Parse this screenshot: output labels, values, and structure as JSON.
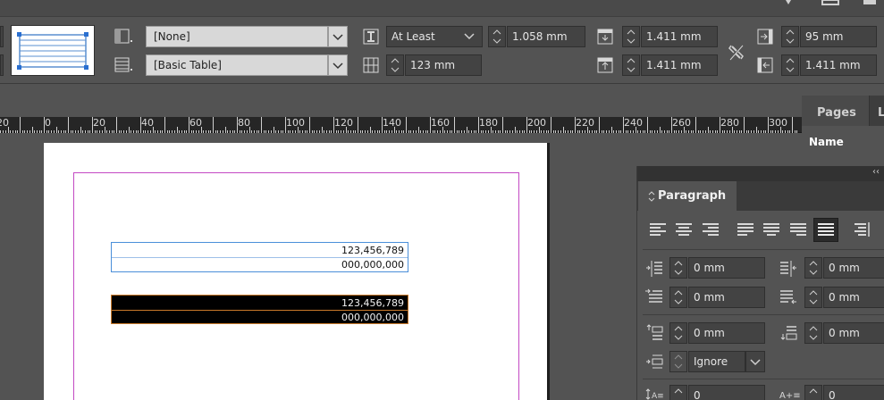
{
  "control_panel": {
    "cell_style_value": "[None]",
    "table_style_value": "[Basic Table]",
    "row_height_mode": "At Least",
    "row_height_value": "1.058 mm",
    "column_width_value": "123 mm",
    "top_inset_value": "1.411 mm",
    "bottom_inset_value": "1.411 mm",
    "right_inset_value": "95 mm",
    "left_inset_value": "1.411 mm"
  },
  "ruler": {
    "labels": [
      "20",
      "0",
      "20",
      "40",
      "60",
      "80",
      "100",
      "120",
      "140",
      "160",
      "180",
      "200",
      "220",
      "240",
      "260",
      "280",
      "300"
    ]
  },
  "pages_panel": {
    "tab_label": "Pages",
    "next_tab_partial": "L",
    "name_header": "Name"
  },
  "table_white": {
    "row1": "123,456,789",
    "row2": "000,000,000"
  },
  "table_black": {
    "row1": "123,456,789",
    "row2": "000,000,000"
  },
  "paragraph_panel": {
    "title": "Paragraph",
    "collapse_glyph": "‹‹",
    "left_indent": "0 mm",
    "right_indent": "0 mm",
    "first_line_indent": "0 mm",
    "last_line_indent": "0 mm",
    "space_before": "0 mm",
    "space_after": "0 mm",
    "grid_align": "Ignore",
    "drop_cap_lines": "0",
    "drop_cap_chars": "0"
  },
  "colors": {
    "margin_guide": "#c349c3",
    "frame_selection": "#4a8fd9",
    "table_stroke_orange": "#c8792a"
  }
}
